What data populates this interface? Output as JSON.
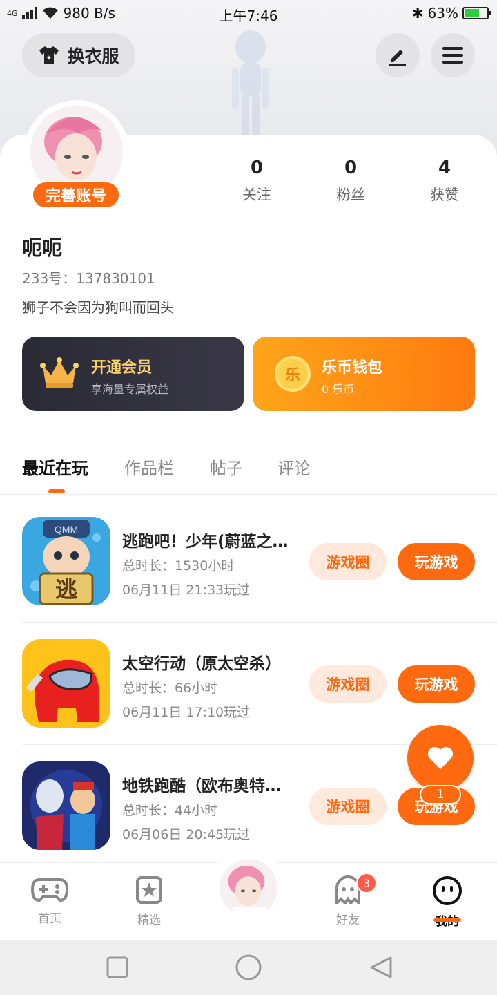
{
  "status_bar": {
    "network": "4G",
    "speed": "980 B/s",
    "time": "上午7:46",
    "battery": "63%",
    "battery_level": 0.63
  },
  "header": {
    "outfit_label": "换衣服",
    "edit_icon": "pencil-icon",
    "menu_icon": "hamburger-icon"
  },
  "profile": {
    "complete_label": "完善账号",
    "name": "呃呃",
    "uid": "233号：137830101",
    "bio": "狮子不会因为狗叫而回头",
    "stats": [
      {
        "num": "0",
        "label": "关注"
      },
      {
        "num": "0",
        "label": "粉丝"
      },
      {
        "num": "4",
        "label": "获赞"
      }
    ]
  },
  "vip": {
    "title": "开通会员",
    "subtitle": "享海量专属权益"
  },
  "wallet": {
    "title": "乐币钱包",
    "subtitle": "0 乐币",
    "icon_char": "乐"
  },
  "tabs": [
    "最近在玩",
    "作品栏",
    "帖子",
    "评论"
  ],
  "games": [
    {
      "title": "逃跑吧！少年(蔚蓝之…",
      "duration": "总时长：1530小时",
      "last_played": "06月11日 21:33玩过",
      "circle_label": "游戏圈",
      "play_label": "玩游戏",
      "icon_text": "逃",
      "icon_banner": "QMM"
    },
    {
      "title": "太空行动（原太空杀）",
      "duration": "总时长：66小时",
      "last_played": "06月11日 17:10玩过",
      "circle_label": "游戏圈",
      "play_label": "玩游戏"
    },
    {
      "title": "地铁跑酷（欧布奥特…",
      "duration": "总时长：44小时",
      "last_played": "06月06日 20:45玩过",
      "circle_label": "游戏圈",
      "play_label": "玩游戏"
    }
  ],
  "floating": {
    "count": "1"
  },
  "bottom_nav": [
    {
      "label": "首页",
      "icon": "gamepad-icon"
    },
    {
      "label": "精选",
      "icon": "star-bookmark-icon"
    },
    {
      "label": "好友",
      "icon": "ghost-icon",
      "badge": "3"
    },
    {
      "label": "我的",
      "icon": "smiley-icon",
      "active": true
    }
  ],
  "colors": {
    "accent": "#ff6a10",
    "vip_dark": "#2a2a35",
    "gold": "#ffd36a"
  }
}
